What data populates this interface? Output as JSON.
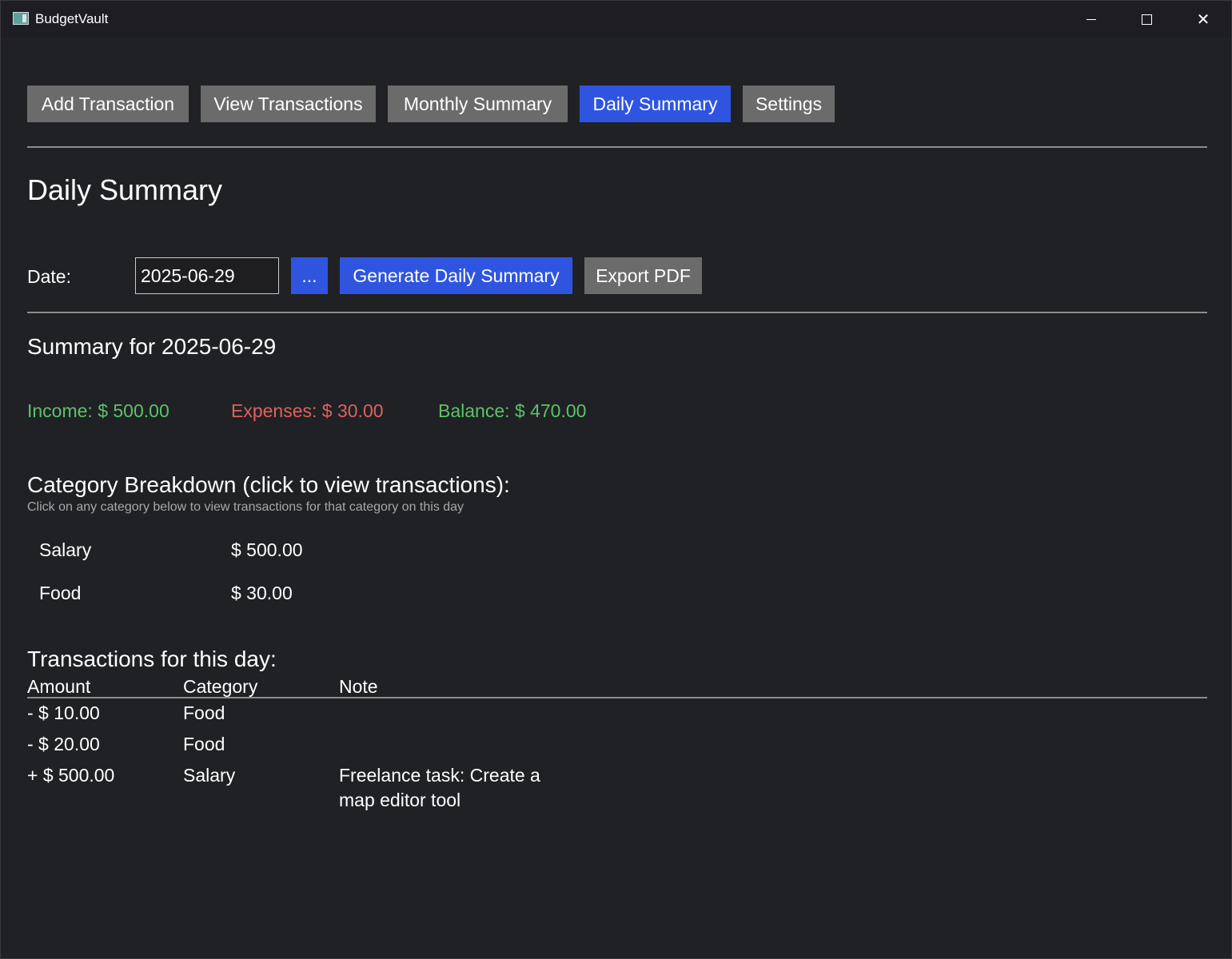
{
  "window": {
    "title": "BudgetVault"
  },
  "tabs": [
    {
      "label": "Add Transaction",
      "active": false
    },
    {
      "label": "View Transactions",
      "active": false
    },
    {
      "label": "Monthly Summary",
      "active": false
    },
    {
      "label": "Daily Summary",
      "active": true
    },
    {
      "label": "Settings",
      "active": false
    }
  ],
  "page": {
    "title": "Daily Summary"
  },
  "date_picker": {
    "label": "Date:",
    "value": "2025-06-29",
    "browse_label": "...",
    "generate_label": "Generate Daily Summary",
    "export_label": "Export PDF"
  },
  "summary": {
    "heading": "Summary for 2025-06-29",
    "income": "Income: $ 500.00",
    "expenses": "Expenses: $ 30.00",
    "balance": "Balance: $ 470.00"
  },
  "breakdown": {
    "heading": "Category Breakdown (click to view transactions):",
    "hint": "Click on any category below to view transactions for that category on this day",
    "items": [
      {
        "category": "Salary",
        "amount": "$ 500.00"
      },
      {
        "category": "Food",
        "amount": "$ 30.00"
      }
    ]
  },
  "transactions": {
    "heading": "Transactions for this day:",
    "columns": [
      "Amount",
      "Category",
      "Note"
    ],
    "rows": [
      {
        "amount": "- $ 10.00",
        "category": "Food",
        "note": "",
        "type": "expense"
      },
      {
        "amount": "- $ 20.00",
        "category": "Food",
        "note": "",
        "type": "expense"
      },
      {
        "amount": "+ $ 500.00",
        "category": "Salary",
        "note": "Freelance task: Create a map editor tool",
        "type": "income"
      }
    ]
  },
  "colors": {
    "accent": "#2f55e0",
    "income": "#5cc26a",
    "expense": "#e06060",
    "background": "#202124"
  }
}
